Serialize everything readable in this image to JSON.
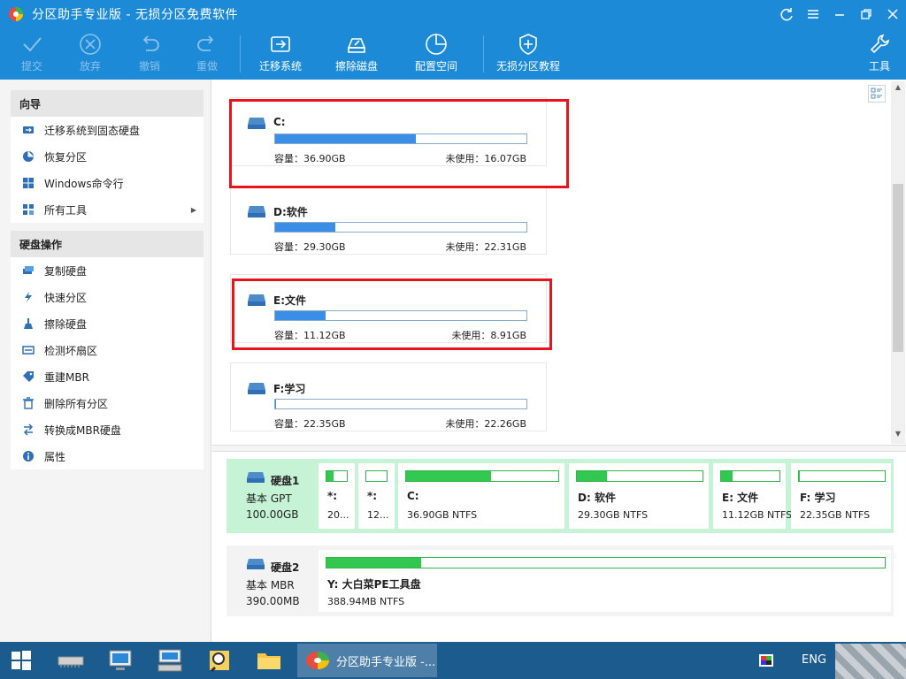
{
  "window": {
    "title": "分区助手专业版 - 无损分区免费软件"
  },
  "toolbar": {
    "commit": "提交",
    "discard": "放弃",
    "undo": "撤销",
    "redo": "重做",
    "migrate": "迁移系统",
    "wipe": "擦除磁盘",
    "allocate": "配置空间",
    "tutorial": "无损分区教程",
    "tools": "工具"
  },
  "sidebar": {
    "wizard": {
      "title": "向导",
      "items": [
        {
          "label": "迁移系统到固态硬盘",
          "icon": "migrate-ssd-icon"
        },
        {
          "label": "恢复分区",
          "icon": "recover-partition-icon"
        },
        {
          "label": "Windows命令行",
          "icon": "windows-icon"
        },
        {
          "label": "所有工具",
          "icon": "all-tools-icon"
        }
      ]
    },
    "disk_ops": {
      "title": "硬盘操作",
      "items": [
        {
          "label": "复制硬盘",
          "icon": "copy-disk-icon"
        },
        {
          "label": "快速分区",
          "icon": "lightning-icon"
        },
        {
          "label": "擦除硬盘",
          "icon": "wipe-disk-icon"
        },
        {
          "label": "检测坏扇区",
          "icon": "check-sector-icon"
        },
        {
          "label": "重建MBR",
          "icon": "rebuild-mbr-icon"
        },
        {
          "label": "删除所有分区",
          "icon": "delete-icon"
        },
        {
          "label": "转换成MBR硬盘",
          "icon": "convert-icon"
        },
        {
          "label": "属性",
          "icon": "info-icon"
        }
      ]
    }
  },
  "partitions": [
    {
      "name": "C:",
      "capacity": "容量：36.90GB",
      "free": "未使用：16.07GB",
      "used_fraction": 0.56
    },
    {
      "name": "D:软件",
      "capacity": "容量：29.30GB",
      "free": "未使用：22.31GB",
      "used_fraction": 0.24
    },
    {
      "name": "E:文件",
      "capacity": "容量：11.12GB",
      "free": "未使用：8.91GB",
      "used_fraction": 0.2
    },
    {
      "name": "F:学习",
      "capacity": "容量：22.35GB",
      "free": "未使用：22.26GB",
      "used_fraction": 0.004
    }
  ],
  "disks": [
    {
      "name": "硬盘1",
      "type": "基本 GPT",
      "size": "100.00GB",
      "parts": [
        {
          "name": "*:",
          "info": "20...",
          "used_fraction": 0.35
        },
        {
          "name": "*:",
          "info": "12...",
          "used_fraction": 0.0
        },
        {
          "name": "C:",
          "info": "36.90GB NTFS",
          "used_fraction": 0.56
        },
        {
          "name": "D: 软件",
          "info": "29.30GB NTFS",
          "used_fraction": 0.24
        },
        {
          "name": "E: 文件",
          "info": "11.12GB NTFS",
          "used_fraction": 0.2
        },
        {
          "name": "F: 学习",
          "info": "22.35GB NTFS",
          "used_fraction": 0.004
        }
      ]
    },
    {
      "name": "硬盘2",
      "type": "基本 MBR",
      "size": "390.00MB",
      "parts": [
        {
          "name": "Y: 大白菜PE工具盘",
          "info": "388.94MB NTFS",
          "used_fraction": 0.17
        }
      ]
    }
  ],
  "taskbar": {
    "app": "分区助手专业版 -...",
    "lang": "ENG"
  },
  "colors": {
    "accent": "#1c8ad6",
    "highlight": "#e8141b",
    "used_bar": "#3b8ee6",
    "disk_bar": "#32c84f",
    "taskbar": "#1c5b8e"
  }
}
